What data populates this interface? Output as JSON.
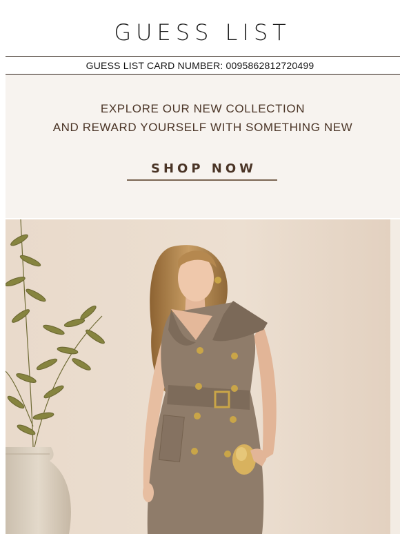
{
  "header": {
    "brand": "GUESS LIST"
  },
  "card": {
    "number_text": "GUESS LIST CARD NUMBER: 0095862812720499"
  },
  "promo": {
    "line1": "EXPLORE OUR NEW COLLECTION",
    "line2": "AND REWARD YOURSELF WITH SOMETHING NEW",
    "cta_label": "SHOP NOW"
  },
  "hero": {
    "image": "woman-in-taupe-sleeveless-trench-dress-photo",
    "colors": {
      "background": "#eadccd",
      "dress": "#8f7c6a",
      "buttons": "#c9a548",
      "hair": "#a77a44",
      "plant": "#7d7a3e",
      "vase": "#d8ccbb"
    }
  },
  "colors": {
    "text_brown": "#4a3426",
    "promo_bg": "#f7f3ef",
    "rule": "#2a1d14"
  }
}
